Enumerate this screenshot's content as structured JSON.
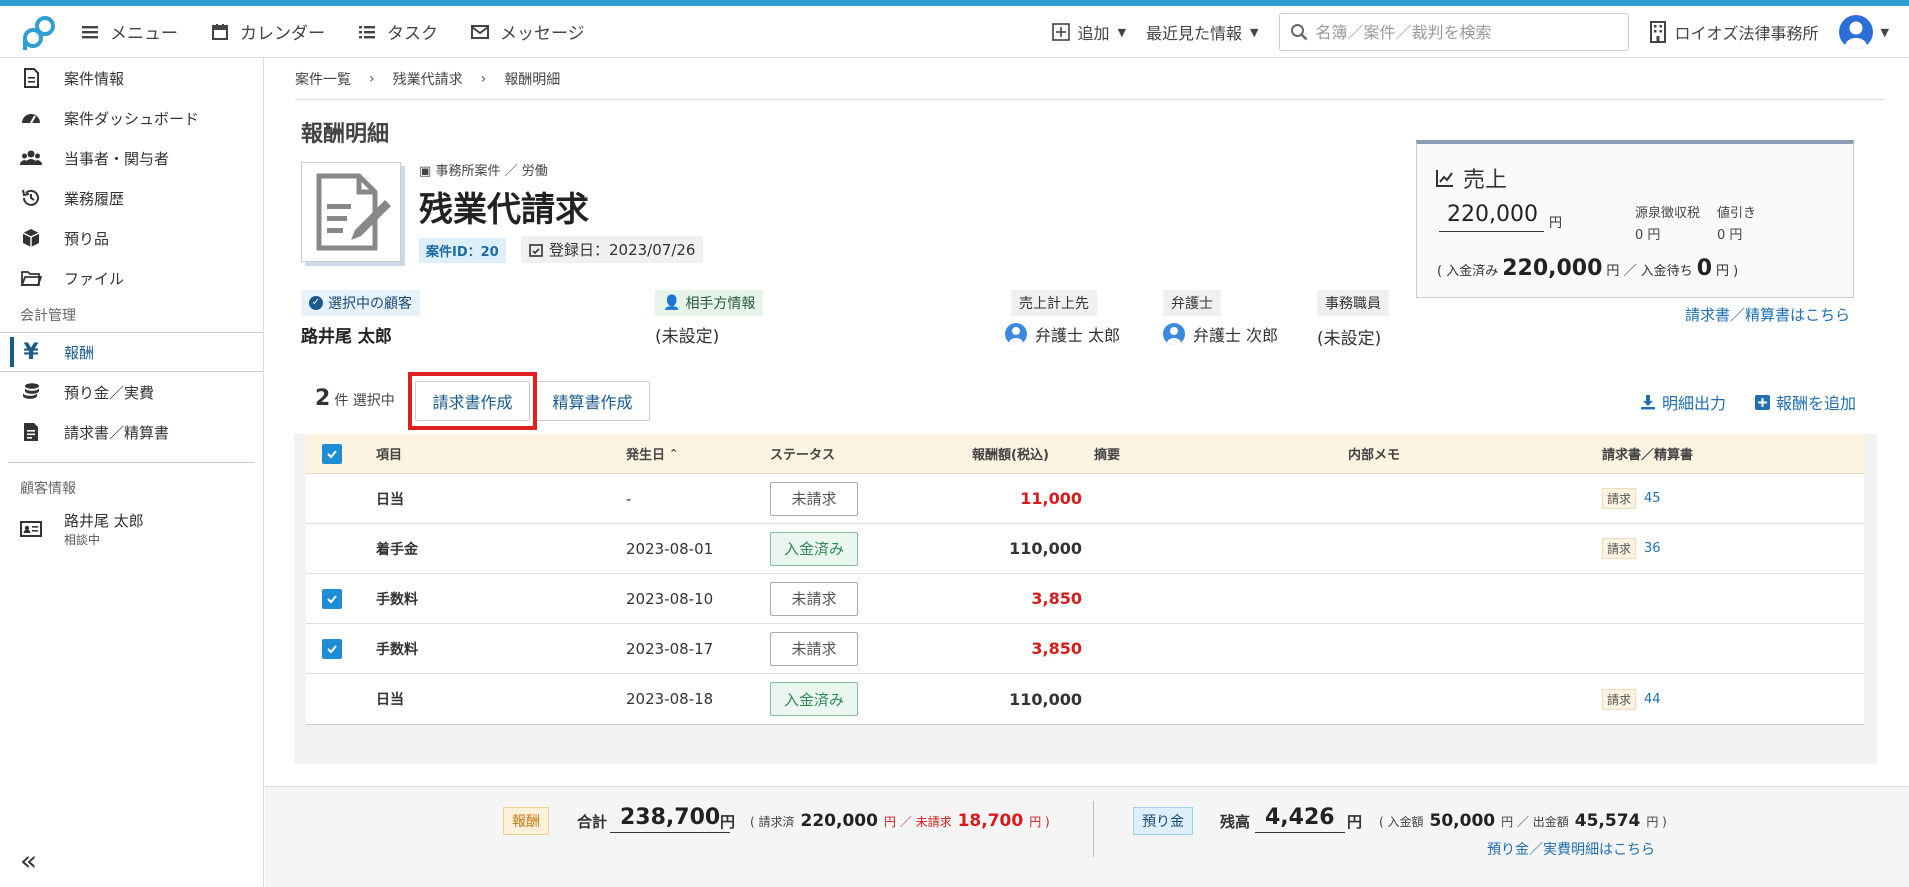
{
  "header": {
    "nav": [
      {
        "label": "メニュー",
        "icon": "menu-icon"
      },
      {
        "label": "カレンダー",
        "icon": "calendar-icon"
      },
      {
        "label": "タスク",
        "icon": "task-list-icon"
      },
      {
        "label": "メッセージ",
        "icon": "mail-icon"
      }
    ],
    "add_label": "追加",
    "recent_label": "最近見た情報",
    "search_placeholder": "名簿／案件／裁判を検索",
    "office_name": "ロイオズ法律事務所"
  },
  "sidebar": {
    "items": [
      {
        "label": "案件情報",
        "icon": "document-icon"
      },
      {
        "label": "案件ダッシュボード",
        "icon": "dashboard-icon"
      },
      {
        "label": "当事者・関与者",
        "icon": "people-icon"
      },
      {
        "label": "業務履歴",
        "icon": "history-icon"
      },
      {
        "label": "預り品",
        "icon": "box-icon"
      },
      {
        "label": "ファイル",
        "icon": "folder-icon"
      }
    ],
    "section_accounting": "会計管理",
    "accounting_items": [
      {
        "label": "報酬",
        "icon": "yen-icon",
        "active": true
      },
      {
        "label": "預り金／実費",
        "icon": "coins-icon"
      },
      {
        "label": "請求書／精算書",
        "icon": "invoice-icon"
      }
    ],
    "section_client": "顧客情報",
    "client": {
      "name": "路井尾 太郎",
      "status": "相談中"
    }
  },
  "breadcrumb": [
    "案件一覧",
    "残業代請求",
    "報酬明細"
  ],
  "page_title": "報酬明細",
  "case": {
    "category": "事務所案件 ／ 労働",
    "title": "残業代請求",
    "id_label": "案件ID：20",
    "registered": "登録日：2023/07/26"
  },
  "parties": {
    "client_label": "選択中の顧客",
    "client_name": "路井尾 太郎",
    "opponent_label": "相手方情報",
    "opponent_value": "(未設定)",
    "sales_to_label": "売上計上先",
    "sales_to": "弁護士 太郎",
    "lawyer_label": "弁護士",
    "lawyer": "弁護士 次郎",
    "staff_label": "事務職員",
    "staff": "(未設定)"
  },
  "sales": {
    "title": "売上",
    "amount": "220,000",
    "yen": "円",
    "withholding_label": "源泉徴収税",
    "withholding_value": "0 円",
    "discount_label": "値引き",
    "discount_value": "0 円",
    "paid_prefix": "( 入金済み",
    "paid_amount": "220,000",
    "paid_mid": "円 ／ 入金待ち",
    "pending_amount": "0",
    "paid_suffix": "円 )",
    "link": "請求書／精算書はこちら"
  },
  "toolbar": {
    "selected_count": "2",
    "selected_label": "件 選択中",
    "invoice_button": "請求書作成",
    "settlement_button": "精算書作成",
    "export_link": "明細出力",
    "add_link": "報酬を追加"
  },
  "table": {
    "headers": {
      "item": "項目",
      "date": "発生日",
      "status": "ステータス",
      "amount": "報酬額(税込)",
      "summary": "摘要",
      "memo": "内部メモ",
      "invoice": "請求書／精算書"
    },
    "rows": [
      {
        "checked": false,
        "item": "日当",
        "date": "-",
        "status": "未請求",
        "paid": false,
        "amount": "11,000",
        "red": true,
        "inv_tag": "請求",
        "inv_num": "45"
      },
      {
        "checked": false,
        "item": "着手金",
        "date": "2023-08-01",
        "status": "入金済み",
        "paid": true,
        "amount": "110,000",
        "red": false,
        "inv_tag": "請求",
        "inv_num": "36"
      },
      {
        "checked": true,
        "item": "手数料",
        "date": "2023-08-10",
        "status": "未請求",
        "paid": false,
        "amount": "3,850",
        "red": true,
        "inv_tag": "",
        "inv_num": ""
      },
      {
        "checked": true,
        "item": "手数料",
        "date": "2023-08-17",
        "status": "未請求",
        "paid": false,
        "amount": "3,850",
        "red": true,
        "inv_tag": "",
        "inv_num": ""
      },
      {
        "checked": false,
        "item": "日当",
        "date": "2023-08-18",
        "status": "入金済み",
        "paid": true,
        "amount": "110,000",
        "red": false,
        "inv_tag": "請求",
        "inv_num": "44"
      }
    ]
  },
  "footer": {
    "fee_tag": "報酬",
    "total_label": "合計",
    "total": "238,700",
    "yen": "円",
    "billed_label": "( 請求済",
    "billed": "220,000",
    "unbilled_label": "円 ／ 未請求",
    "unbilled": "18,700",
    "close": "円 )",
    "deposit_tag": "預り金",
    "balance_label": "残高",
    "balance": "4,426",
    "in_label": "( 入金額",
    "in_amount": "50,000",
    "out_label": "円 ／ 出金額",
    "out_amount": "45,574",
    "deposit_link": "預り金／実費明細はこちら"
  }
}
